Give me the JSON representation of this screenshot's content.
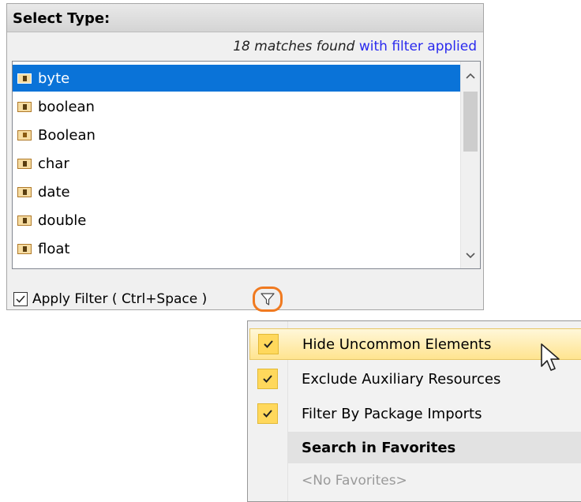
{
  "panel": {
    "title": "Select Type:",
    "match_count": "18 matches found",
    "filter_link": "with filter applied",
    "items": [
      {
        "label": "byte",
        "selected": true,
        "icon": "data-type-icon"
      },
      {
        "label": "boolean",
        "selected": false,
        "icon": "data-type-icon"
      },
      {
        "label": "Boolean",
        "selected": false,
        "icon": "primitive-type-icon"
      },
      {
        "label": "char",
        "selected": false,
        "icon": "data-type-icon"
      },
      {
        "label": "date",
        "selected": false,
        "icon": "data-type-icon"
      },
      {
        "label": "double",
        "selected": false,
        "icon": "data-type-icon"
      },
      {
        "label": "float",
        "selected": false,
        "icon": "data-type-icon"
      }
    ],
    "apply_filter_label": "Apply Filter ( Ctrl+Space )",
    "apply_filter_checked": true
  },
  "menu": {
    "items": [
      {
        "label": "Hide Uncommon Elements",
        "checked": true,
        "highlighted": true
      },
      {
        "label": "Exclude Auxiliary Resources",
        "checked": true
      },
      {
        "label": "Filter By Package Imports",
        "checked": true
      }
    ],
    "section_header": "Search in Favorites",
    "empty_favorites": "<No Favorites>"
  },
  "colors": {
    "selection": "#0a73d8",
    "link": "#2a2aee",
    "filter_highlight_ring": "#f07a20",
    "menu_check_bg": "#ffd85c"
  }
}
